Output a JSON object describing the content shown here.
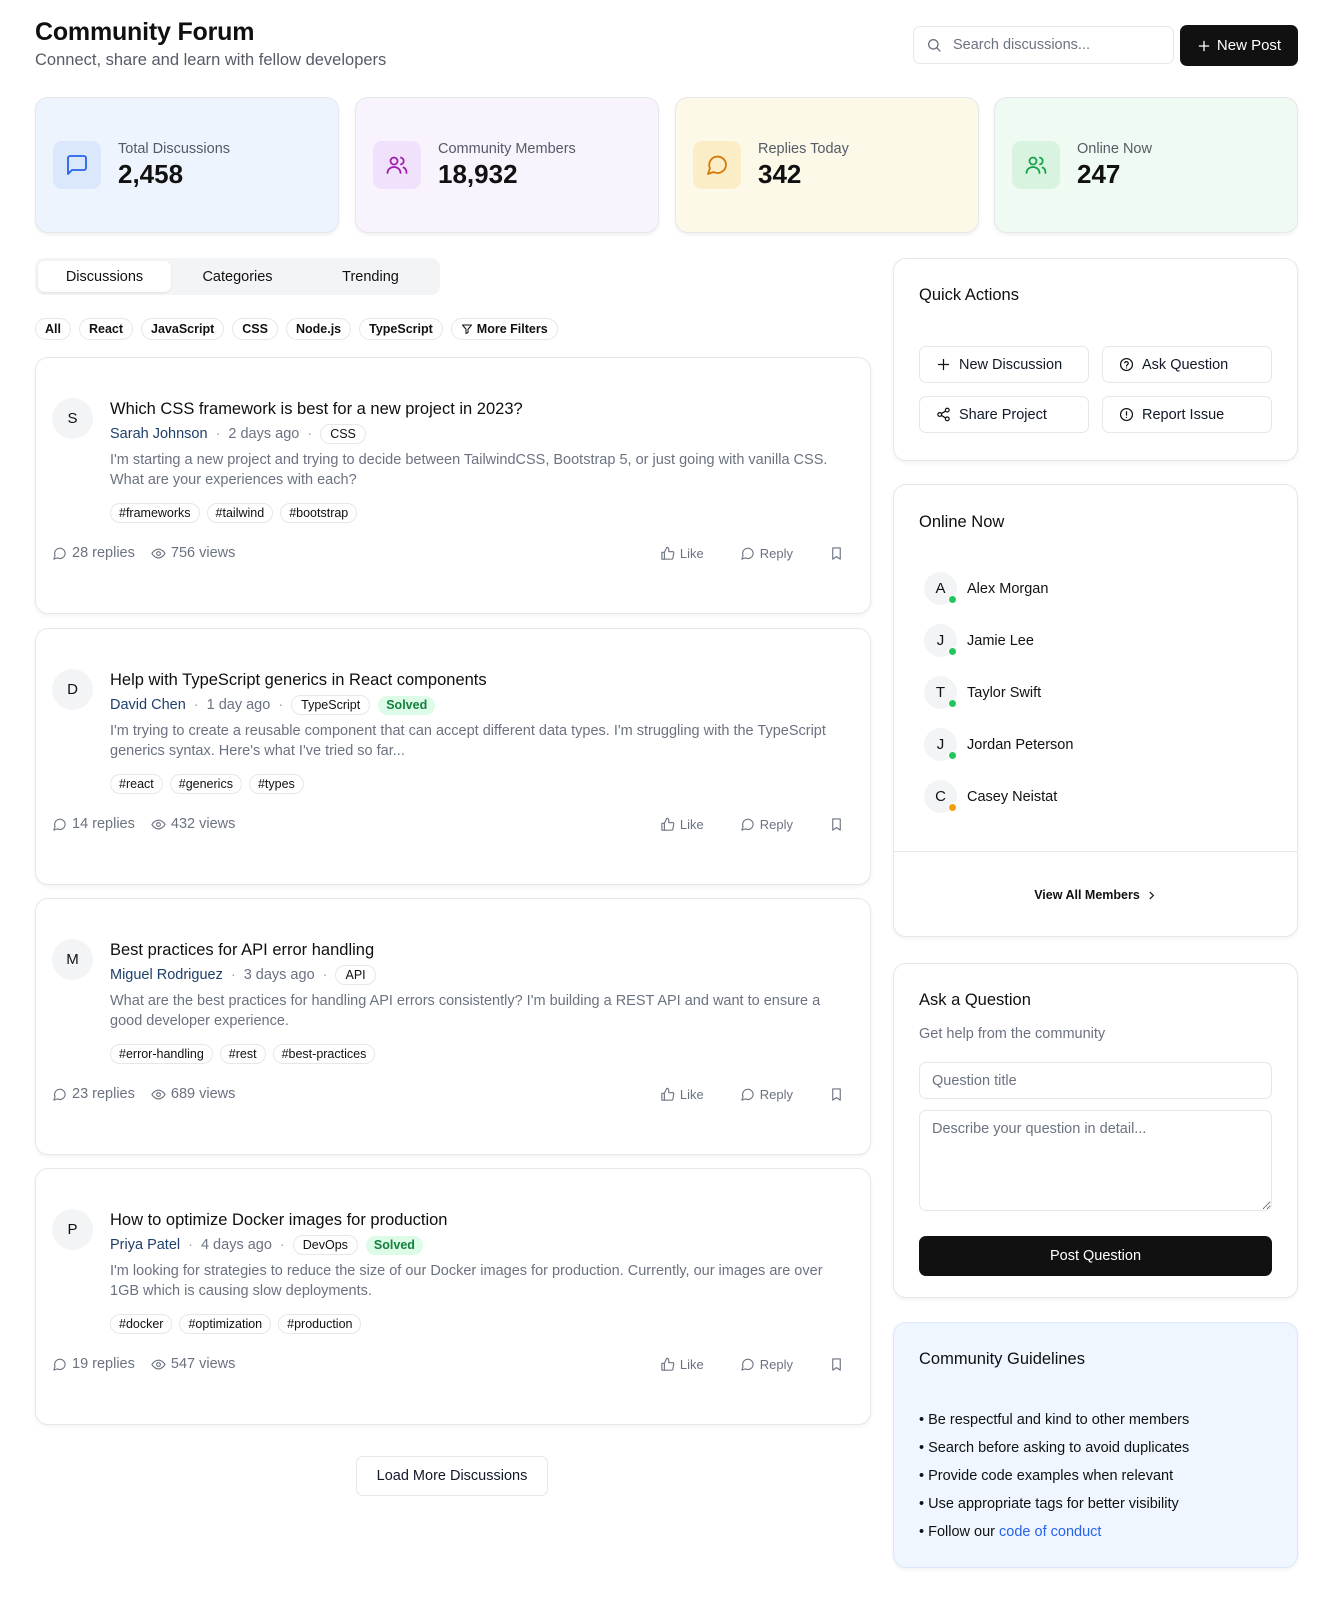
{
  "header": {
    "title": "Community Forum",
    "subtitle": "Connect, share and learn with fellow developers",
    "search_placeholder": "Search discussions...",
    "new_post_label": "New Post"
  },
  "stats": [
    {
      "label": "Total Discussions",
      "value": "2,458",
      "icon": "message-square-icon",
      "accent": "#2563eb",
      "bg": "#eef4fd",
      "icon_bg": "#dbe7fb"
    },
    {
      "label": "Community Members",
      "value": "18,932",
      "icon": "users-icon",
      "accent": "#a21caf",
      "bg": "#f8f3fd",
      "icon_bg": "#f0e2fb"
    },
    {
      "label": "Replies Today",
      "value": "342",
      "icon": "message-circle-icon",
      "accent": "#d97706",
      "bg": "#fdf9e9",
      "icon_bg": "#fbeec7"
    },
    {
      "label": "Online Now",
      "value": "247",
      "icon": "users-online-icon",
      "accent": "#16a34a",
      "bg": "#effbf2",
      "icon_bg": "#d8f4e0"
    }
  ],
  "tabs": [
    "Discussions",
    "Categories",
    "Trending"
  ],
  "filters": [
    "All",
    "React",
    "JavaScript",
    "CSS",
    "Node.js",
    "TypeScript",
    "More Filters"
  ],
  "posts": [
    {
      "initial": "S",
      "title": "Which CSS framework is best for a new project in 2023?",
      "author": "Sarah Johnson",
      "time": "2 days ago",
      "category": "CSS",
      "solved": "",
      "excerpt": "I'm starting a new project and trying to decide between TailwindCSS, Bootstrap 5, or just going with vanilla CSS. What are your experiences with each?",
      "tags": [
        "#frameworks",
        "#tailwind",
        "#bootstrap"
      ],
      "replies": "28 replies",
      "views": "756 views"
    },
    {
      "initial": "D",
      "title": "Help with TypeScript generics in React components",
      "author": "David Chen",
      "time": "1 day ago",
      "category": "TypeScript",
      "solved": "Solved",
      "excerpt": "I'm trying to create a reusable component that can accept different data types. I'm struggling with the TypeScript generics syntax. Here's what I've tried so far...",
      "tags": [
        "#react",
        "#generics",
        "#types"
      ],
      "replies": "14 replies",
      "views": "432 views"
    },
    {
      "initial": "M",
      "title": "Best practices for API error handling",
      "author": "Miguel Rodriguez",
      "time": "3 days ago",
      "category": "API",
      "solved": "",
      "excerpt": "What are the best practices for handling API errors consistently? I'm building a REST API and want to ensure a good developer experience.",
      "tags": [
        "#error-handling",
        "#rest",
        "#best-practices"
      ],
      "replies": "23 replies",
      "views": "689 views"
    },
    {
      "initial": "P",
      "title": "How to optimize Docker images for production",
      "author": "Priya Patel",
      "time": "4 days ago",
      "category": "DevOps",
      "solved": "Solved",
      "excerpt": "I'm looking for strategies to reduce the size of our Docker images for production. Currently, our images are over 1GB which is causing slow deployments.",
      "tags": [
        "#docker",
        "#optimization",
        "#production"
      ],
      "replies": "19 replies",
      "views": "547 views"
    }
  ],
  "post_actions": {
    "like": "Like",
    "reply": "Reply"
  },
  "load_more_label": "Load More Discussions",
  "quick_actions": {
    "title": "Quick Actions",
    "buttons": [
      "New Discussion",
      "Ask Question",
      "Share Project",
      "Report Issue"
    ]
  },
  "online_now": {
    "title": "Online Now",
    "members": [
      {
        "initial": "A",
        "name": "Alex Morgan",
        "status_color": "#22c55e"
      },
      {
        "initial": "J",
        "name": "Jamie Lee",
        "status_color": "#22c55e"
      },
      {
        "initial": "T",
        "name": "Taylor Swift",
        "status_color": "#22c55e"
      },
      {
        "initial": "J",
        "name": "Jordan Peterson",
        "status_color": "#22c55e"
      },
      {
        "initial": "C",
        "name": "Casey Neistat",
        "status_color": "#f59e0b"
      }
    ],
    "view_all_label": "View All Members"
  },
  "ask_question": {
    "title": "Ask a Question",
    "subtitle": "Get help from the community",
    "title_placeholder": "Question title",
    "detail_placeholder": "Describe your question in detail...",
    "submit_label": "Post Question"
  },
  "guidelines": {
    "title": "Community Guidelines",
    "items": [
      "Be respectful and kind to other members",
      "Search before asking to avoid duplicates",
      "Provide code examples when relevant",
      "Use appropriate tags for better visibility"
    ],
    "last_item_prefix": "Follow our",
    "last_item_link": "code of conduct"
  }
}
